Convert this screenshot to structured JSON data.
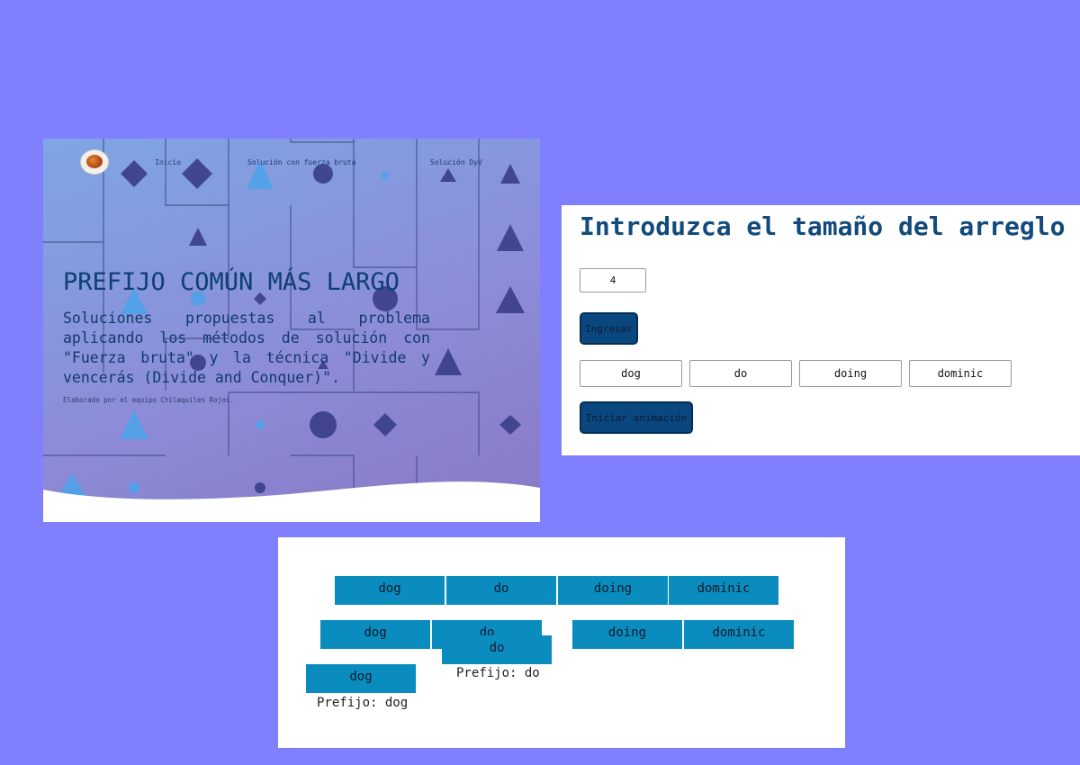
{
  "hero": {
    "logo_alt": "Chilaquiles",
    "nav": [
      "Inicio",
      "Solución con fuerza bruta",
      "Solución DyV"
    ],
    "title": "PREFIJO COMÚN MÁS LARGO",
    "description": "Soluciones propuestas al problema aplicando los métodos de solución con \"Fuerza bruta\" y la técnica \"Divide y vencerás (Divide and Conquer)\".",
    "credit": "Elaborado por el equipo Chilaquiles Rojos."
  },
  "form": {
    "heading": "Introduzca el tamaño del arreglo",
    "size_value": "4",
    "submit_label": "Ingresar",
    "words": [
      "dog",
      "do",
      "doing",
      "dominic"
    ],
    "start_label": "Iniciar animación"
  },
  "animation": {
    "level0": [
      "dog",
      "do",
      "doing",
      "dominic"
    ],
    "level1_left": [
      "dog",
      "do"
    ],
    "level1_right": [
      "doing",
      "dominic"
    ],
    "level2_left": "dog",
    "level2_right": "do",
    "level2_right_ghost": "do",
    "prefix_left": "Prefijo: dog",
    "prefix_right": "Prefijo: do"
  },
  "colors": {
    "background": "#8080ff",
    "heading": "#124a7c",
    "button": "#0a477e",
    "cell": "#0a8cbf"
  },
  "icons": [
    "food-logo-icon"
  ]
}
